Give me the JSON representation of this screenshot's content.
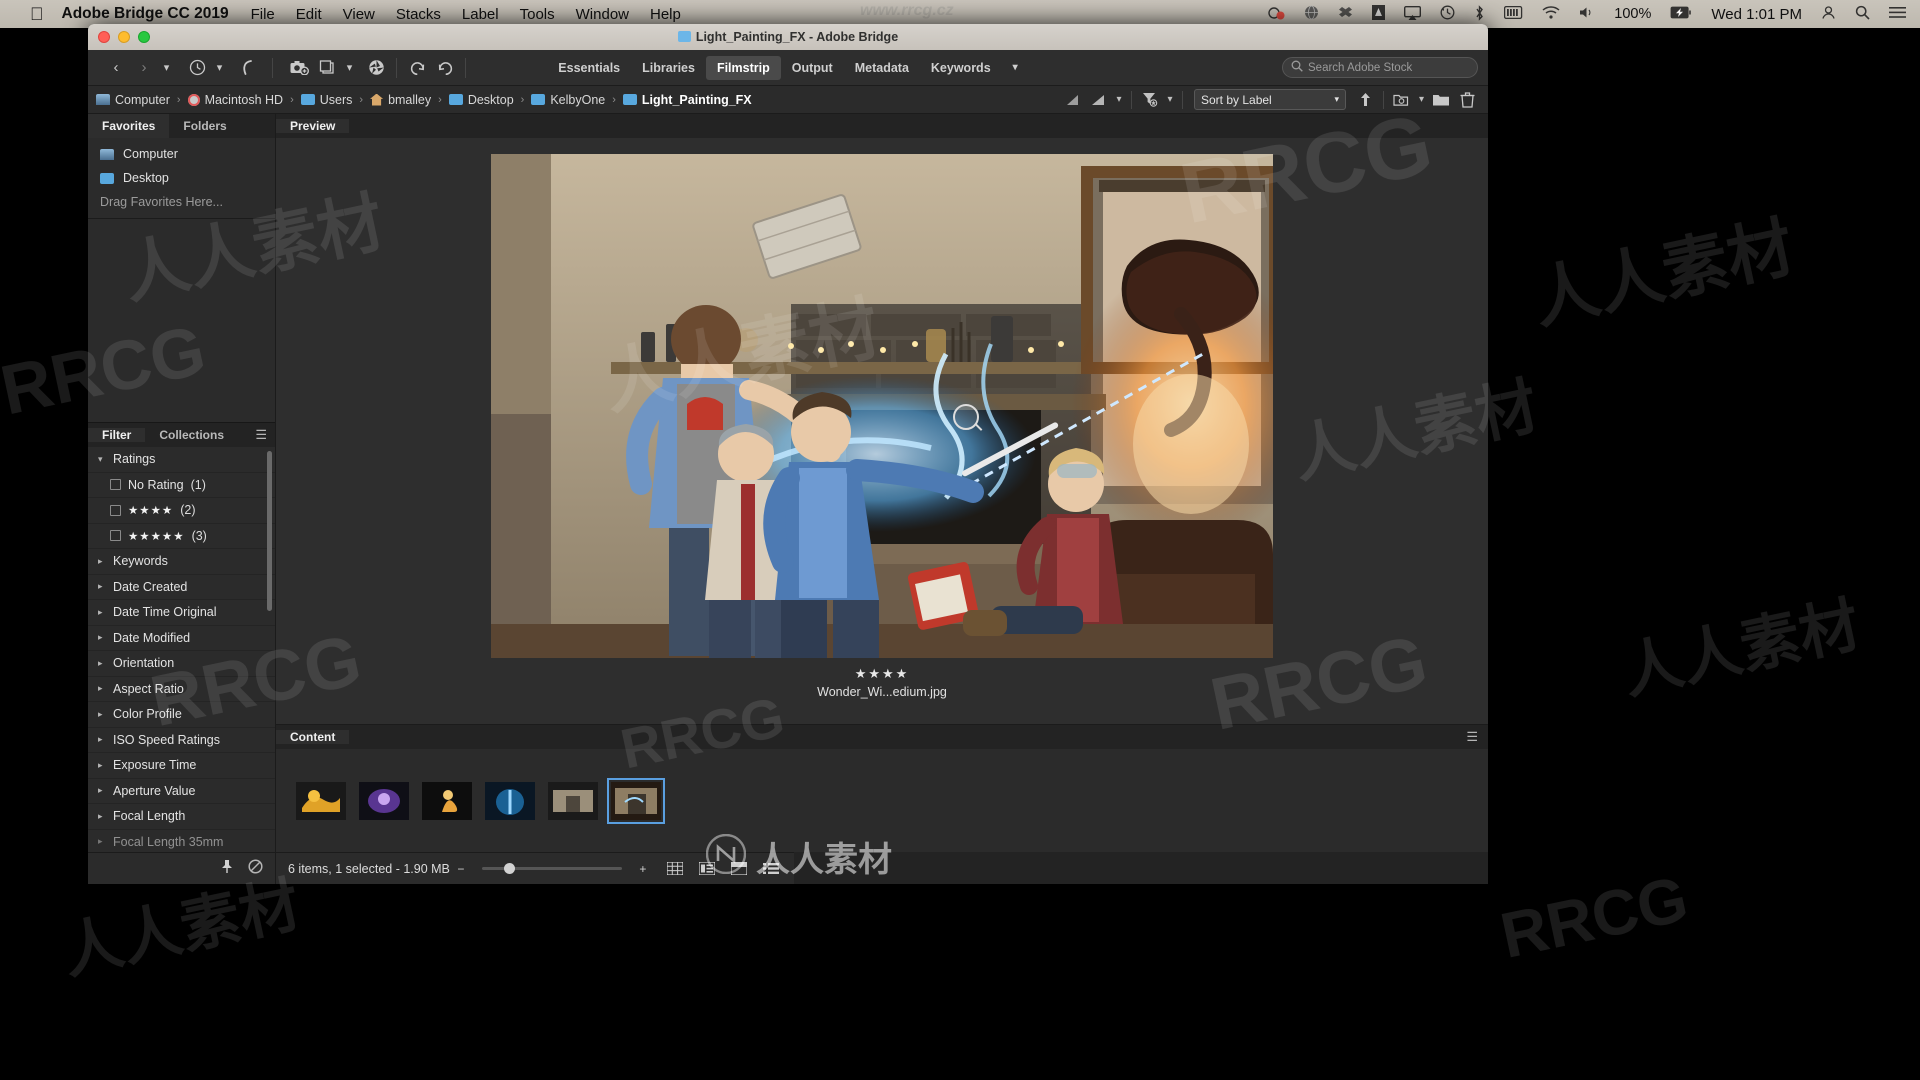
{
  "menubar": {
    "apple_icon": "apple-logo",
    "app_name": "Adobe Bridge CC 2019",
    "items": [
      "File",
      "Edit",
      "View",
      "Stacks",
      "Label",
      "Tools",
      "Window",
      "Help"
    ],
    "status_icons": [
      "timemachine-badge-icon",
      "globe-icon",
      "dropbox-icon",
      "drive-icon",
      "airplay-icon",
      "timemachine-icon",
      "bluetooth-icon",
      "battery-bar-icon",
      "wifi-icon",
      "volume-icon"
    ],
    "battery_percent": "100%",
    "battery_icon": "battery-charging-icon",
    "clock": "Wed 1:01 PM",
    "user_icon": "user-icon",
    "spotlight_icon": "search-icon",
    "controlcenter_icon": "list-icon"
  },
  "window": {
    "title": "Light_Painting_FX - Adobe Bridge",
    "title_icon": "folder-icon"
  },
  "toolbar": {
    "back_icon": "chevron-left-icon",
    "forward_icon": "chevron-right-icon",
    "dropdown_icon": "chevron-down-icon",
    "recent_icon": "clock-history-icon",
    "boomerang_icon": "go-parent-icon",
    "camera_icon": "get-photos-from-camera-icon",
    "refine_icon": "refine-icon",
    "camera_raw_icon": "open-in-camera-raw-icon",
    "rotate_ccw_icon": "rotate-counterclockwise-icon",
    "rotate_cw_icon": "rotate-clockwise-icon",
    "workspaces": [
      {
        "label": "Essentials",
        "active": false
      },
      {
        "label": "Libraries",
        "active": false
      },
      {
        "label": "Filmstrip",
        "active": true
      },
      {
        "label": "Output",
        "active": false
      },
      {
        "label": "Metadata",
        "active": false
      },
      {
        "label": "Keywords",
        "active": false
      }
    ],
    "workspace_more_icon": "chevron-down-icon",
    "search": {
      "icon": "adobe-stock-search-icon",
      "placeholder": "Search Adobe Stock",
      "value": ""
    }
  },
  "breadcrumb": {
    "items": [
      {
        "label": "Computer",
        "icon": "computer-icon"
      },
      {
        "label": "Macintosh HD",
        "icon": "harddrive-icon"
      },
      {
        "label": "Users",
        "icon": "folder-users-icon"
      },
      {
        "label": "bmalley",
        "icon": "home-icon"
      },
      {
        "label": "Desktop",
        "icon": "folder-icon"
      },
      {
        "label": "KelbyOne",
        "icon": "folder-icon"
      },
      {
        "label": "Light_Painting_FX",
        "icon": "folder-icon"
      }
    ],
    "separator": "›",
    "right_controls": {
      "filter_rating_icon": "filter-rating-icon",
      "filter_rating_menu_icon": "filter-rating-menu-icon",
      "sort_filter_icon": "filter-funnel-icon",
      "sort_label": "Sort by Label",
      "sort_caret_icon": "chevron-down-icon",
      "up_icon": "arrow-up-icon",
      "new_subfolder_icon": "new-folder-camera-icon",
      "new_folder_icon": "new-folder-icon",
      "delete_icon": "trash-icon"
    }
  },
  "left_panel": {
    "top_tabs": [
      {
        "label": "Favorites",
        "active": true
      },
      {
        "label": "Folders",
        "active": false
      }
    ],
    "favorites": [
      {
        "label": "Computer",
        "icon": "computer-icon"
      },
      {
        "label": "Desktop",
        "icon": "folder-icon"
      }
    ],
    "drag_hint": "Drag Favorites Here...",
    "bottom_tabs": [
      {
        "label": "Filter",
        "active": true
      },
      {
        "label": "Collections",
        "active": false
      }
    ],
    "panel_menu_icon": "hamburger-icon",
    "filter_groups": [
      {
        "label": "Ratings",
        "expanded": true,
        "chevron": "chevron-down-icon"
      },
      {
        "label": "Keywords",
        "expanded": false,
        "chevron": "chevron-right-icon"
      },
      {
        "label": "Date Created",
        "expanded": false,
        "chevron": "chevron-right-icon"
      },
      {
        "label": "Date Time Original",
        "expanded": false,
        "chevron": "chevron-right-icon"
      },
      {
        "label": "Date Modified",
        "expanded": false,
        "chevron": "chevron-right-icon"
      },
      {
        "label": "Orientation",
        "expanded": false,
        "chevron": "chevron-right-icon"
      },
      {
        "label": "Aspect Ratio",
        "expanded": false,
        "chevron": "chevron-right-icon"
      },
      {
        "label": "Color Profile",
        "expanded": false,
        "chevron": "chevron-right-icon"
      },
      {
        "label": "ISO Speed Ratings",
        "expanded": false,
        "chevron": "chevron-right-icon"
      },
      {
        "label": "Exposure Time",
        "expanded": false,
        "chevron": "chevron-right-icon"
      },
      {
        "label": "Aperture Value",
        "expanded": false,
        "chevron": "chevron-right-icon"
      },
      {
        "label": "Focal Length",
        "expanded": false,
        "chevron": "chevron-right-icon"
      },
      {
        "label": "Focal Length 35mm",
        "expanded": false,
        "chevron": "chevron-right-icon"
      }
    ],
    "ratings": [
      {
        "label": "No Rating",
        "stars": 0,
        "count": "(1)",
        "checked": false
      },
      {
        "label": "",
        "stars": 4,
        "count": "(2)",
        "checked": false
      },
      {
        "label": "",
        "stars": 5,
        "count": "(3)",
        "checked": false
      }
    ],
    "footer": {
      "keep_filter_icon": "pushpin-icon",
      "clear_filter_icon": "clear-filter-icon"
    }
  },
  "preview": {
    "tab_label": "Preview",
    "stars": "★★★★",
    "star_count": 4,
    "filename": "Wonder_Wi...edium.jpg",
    "loupe_icon": "loupe-zoom-icon"
  },
  "content": {
    "tab_label": "Content",
    "panel_menu_icon": "hamburger-icon",
    "thumbnails": [
      {
        "name": "thumb-1",
        "selected": false
      },
      {
        "name": "thumb-2",
        "selected": false
      },
      {
        "name": "thumb-3",
        "selected": false
      },
      {
        "name": "thumb-4",
        "selected": false
      },
      {
        "name": "thumb-5",
        "selected": false
      },
      {
        "name": "thumb-6",
        "selected": true
      }
    ]
  },
  "status_bar": {
    "text": "6 items, 1 selected - 1.90 MB",
    "zoom_out_icon": "minus-icon",
    "zoom_in_icon": "plus-icon",
    "view_icons": [
      "grid-view-icon",
      "details-view-icon",
      "list-view-icon",
      "compact-view-icon"
    ]
  },
  "watermarks": {
    "big": "人人素材",
    "rr": "RRCG",
    "site": "www.rrcg.cz",
    "logo": "人人素材"
  },
  "colors": {
    "accent": "#5a9fe0",
    "panel_bg": "#2b2b2b",
    "toolbar_bg": "#2e2e2e",
    "menubar_bg": "#c9c4bb"
  }
}
